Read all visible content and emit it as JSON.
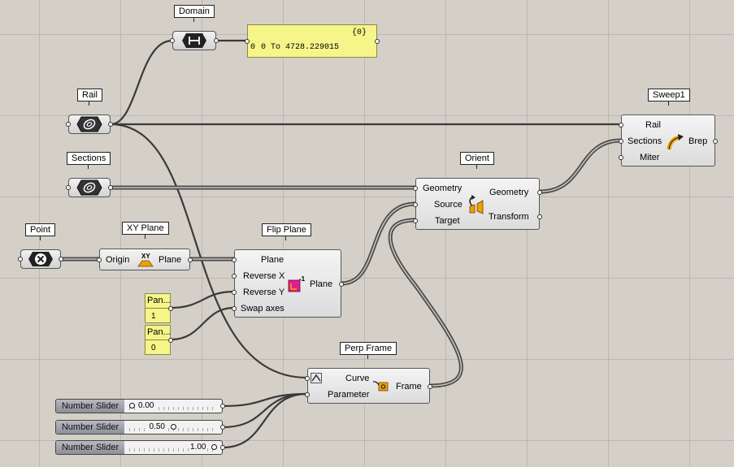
{
  "tags": {
    "domain": "Domain",
    "rail": "Rail",
    "sections": "Sections",
    "point": "Point",
    "xy_plane": "XY Plane",
    "flip_plane": "Flip Plane",
    "orient": "Orient",
    "sweep1": "Sweep1",
    "perp_frame": "Perp Frame"
  },
  "domain_panel": {
    "path": "{0}",
    "index": "0",
    "value": "0 To 4728.229015"
  },
  "xy_plane": {
    "input": "Origin",
    "output": "Plane"
  },
  "flip_plane": {
    "inputs": [
      "Plane",
      "Reverse X",
      "Reverse Y",
      "Swap axes"
    ],
    "output": "Plane"
  },
  "orient": {
    "inputs": [
      "Geometry",
      "Source",
      "Target"
    ],
    "outputs": [
      "Geometry",
      "Transform"
    ]
  },
  "sweep1": {
    "inputs": [
      "Rail",
      "Sections",
      "Miter"
    ],
    "output": "Brep"
  },
  "perp_frame": {
    "inputs": [
      "Curve",
      "Parameter"
    ],
    "output": "Frame"
  },
  "panels": [
    {
      "title": "Pan...",
      "value": "1"
    },
    {
      "title": "Pan...",
      "value": "0"
    }
  ],
  "sliders": [
    {
      "name": "Number Slider",
      "value": "0.00",
      "fraction": 0.0
    },
    {
      "name": "Number Slider",
      "value": "0.50",
      "fraction": 0.5
    },
    {
      "name": "Number Slider",
      "value": "1.00",
      "fraction": 1.0
    }
  ],
  "icons": {
    "domain": "domain-bracket-icon",
    "rail": "curve-param-icon",
    "sections": "curve-param-icon",
    "point": "point-param-icon",
    "xy_plane": "xy-plane-icon",
    "flip_plane": "flip-plane-icon",
    "orient": "orient-icon",
    "sweep1": "sweep-icon",
    "perp_frame": "perp-frame-icon"
  },
  "colors": {
    "canvas": "#d4d0c8",
    "panel_yellow": "#f5f58a",
    "orange_icon": "#f0a000",
    "magenta_icon": "#e0208a"
  }
}
